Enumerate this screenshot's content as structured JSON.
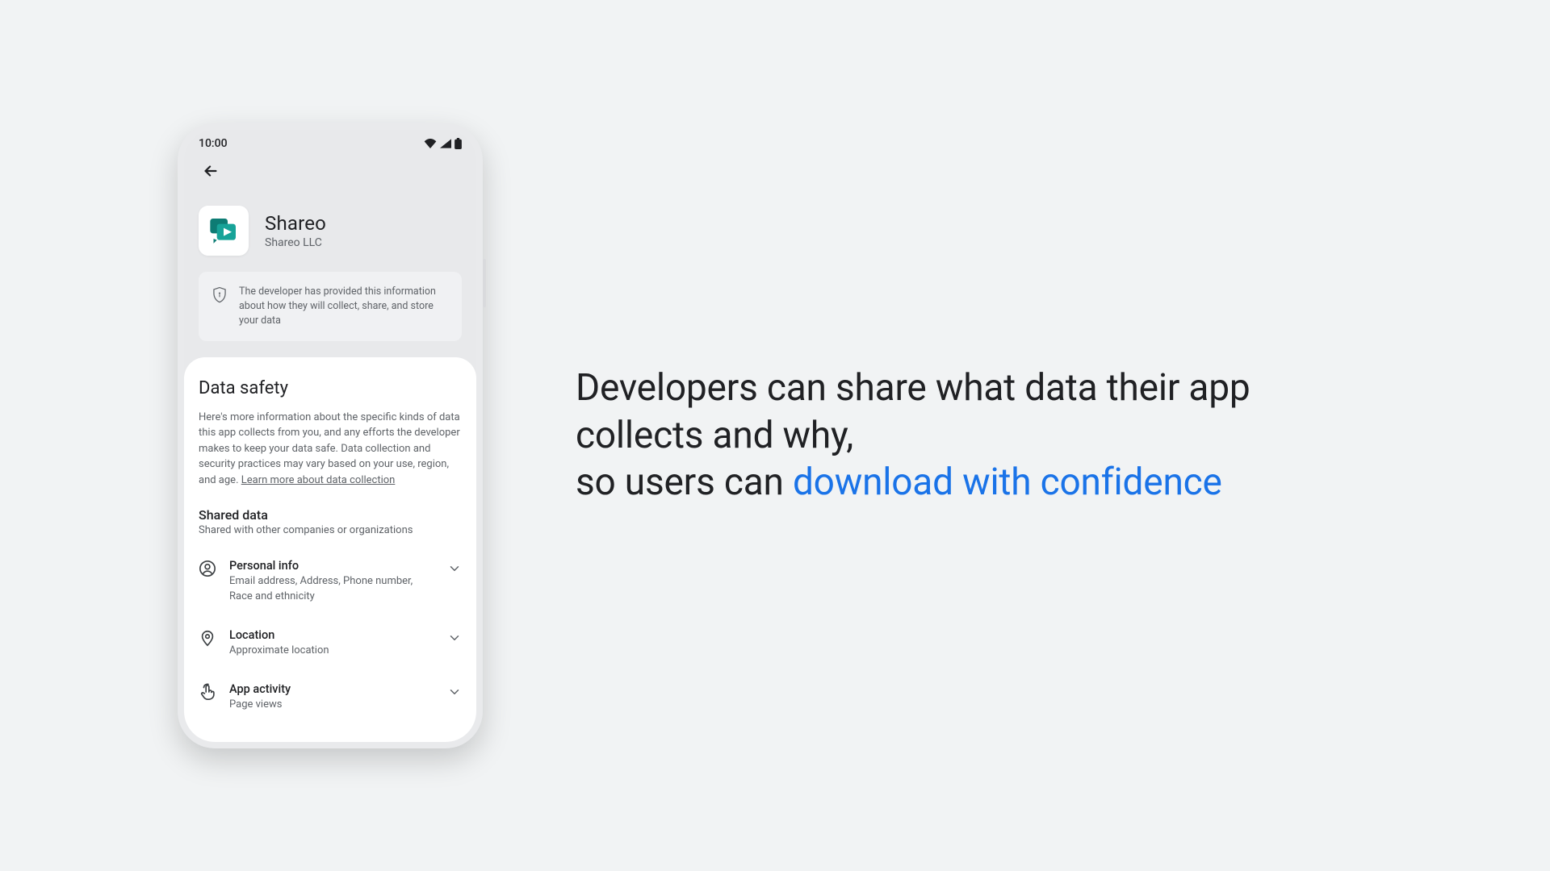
{
  "status": {
    "time": "10:00"
  },
  "app": {
    "name": "Shareo",
    "developer": "Shareo LLC"
  },
  "banner": {
    "text": "The developer has provided this information about how they will collect, share, and store your data"
  },
  "safety": {
    "heading": "Data safety",
    "description": "Here's more information about the specific kinds of data this app collects from you, and any efforts the developer makes to keep your data safe. Data collection and security practices may vary based on your use, region, and age. ",
    "learnMore": "Learn more about data collection"
  },
  "shared": {
    "title": "Shared data",
    "subtitle": "Shared with other companies or organizations",
    "items": [
      {
        "icon": "person",
        "title": "Personal info",
        "subtitle": "Email address, Address, Phone number, Race and ethnicity"
      },
      {
        "icon": "location",
        "title": "Location",
        "subtitle": "Approximate location"
      },
      {
        "icon": "touch",
        "title": "App activity",
        "subtitle": "Page views"
      }
    ]
  },
  "slide": {
    "plain": "Developers can share what data their app collects and why,\nso users can ",
    "accent": "download with confidence"
  }
}
